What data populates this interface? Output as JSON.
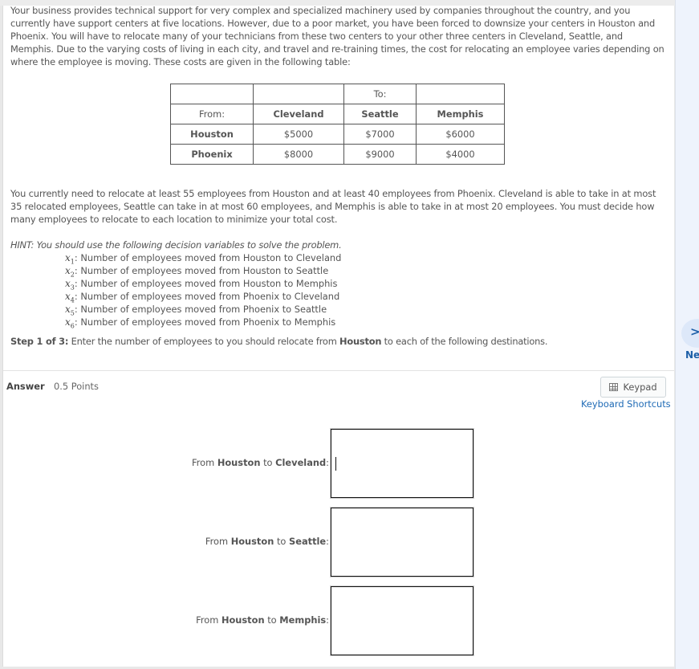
{
  "question": {
    "intro": "Your business provides technical support for very complex and specialized machinery used by companies throughout the country, and you currently have support centers at five locations.  However, due to a poor market, you have been forced to downsize your centers in Houston and Phoenix.  You will have to relocate many of your technicians from these two centers to your other three centers in Cleveland, Seattle, and Memphis.  Due to the varying costs of living in each city, and travel and re-training times, the cost for relocating an employee varies depending on where the employee is moving.  These costs are given in the following table:",
    "table": {
      "to_label": "To:",
      "from_label": "From:",
      "columns": [
        "Cleveland",
        "Seattle",
        "Memphis"
      ],
      "rows": [
        {
          "from": "Houston",
          "costs": [
            "$5000",
            "$7000",
            "$6000"
          ]
        },
        {
          "from": "Phoenix",
          "costs": [
            "$8000",
            "$9000",
            "$4000"
          ]
        }
      ]
    },
    "constraints": "You currently need to relocate at least 55 employees from Houston and at least 40 employees from Phoenix.  Cleveland is able to take in at most 35 relocated employees, Seattle can take in at most 60 employees, and Memphis is able to take in at most 20 employees.  You must decide how many employees to relocate to each location to minimize your total cost.",
    "hint": "HINT: You should use the following decision variables to solve the problem.",
    "variables": [
      {
        "sym": "x",
        "sub": "1",
        "desc": ": Number of employees moved from Houston to Cleveland"
      },
      {
        "sym": "x",
        "sub": "2",
        "desc": ": Number of employees moved from Houston to Seattle"
      },
      {
        "sym": "x",
        "sub": "3",
        "desc": ": Number of employees moved from Houston to Memphis"
      },
      {
        "sym": "x",
        "sub": "4",
        "desc": ": Number of employees moved from Phoenix to Cleveland"
      },
      {
        "sym": "x",
        "sub": "5",
        "desc": ": Number of employees moved from Phoenix to Seattle"
      },
      {
        "sym": "x",
        "sub": "6",
        "desc": ": Number of employees moved from Phoenix to Memphis"
      }
    ],
    "step": {
      "label": "Step 1 of 3:",
      "text_before": " Enter the number of employees to you should relocate from ",
      "bold_city": "Houston",
      "text_after": " to each of the following destinations."
    }
  },
  "answer": {
    "label": "Answer",
    "points": "0.5 Points",
    "keypad_label": "Keypad",
    "shortcuts_label": "Keyboard Shortcuts",
    "fields": [
      {
        "prefix": "From ",
        "from": "Houston",
        "mid": " to ",
        "to": "Cleveland",
        "suffix": ":",
        "value": ""
      },
      {
        "prefix": "From ",
        "from": "Houston",
        "mid": " to ",
        "to": "Seattle",
        "suffix": ":",
        "value": ""
      },
      {
        "prefix": "From ",
        "from": "Houston",
        "mid": " to ",
        "to": "Memphis",
        "suffix": ":",
        "value": ""
      }
    ]
  },
  "nav": {
    "next_label": "Ne",
    "next_icon": "chevron-right-icon"
  },
  "colors": {
    "link": "#1e6ab5",
    "side_panel": "#eef3fc",
    "next_accent": "#1d5fa8"
  }
}
